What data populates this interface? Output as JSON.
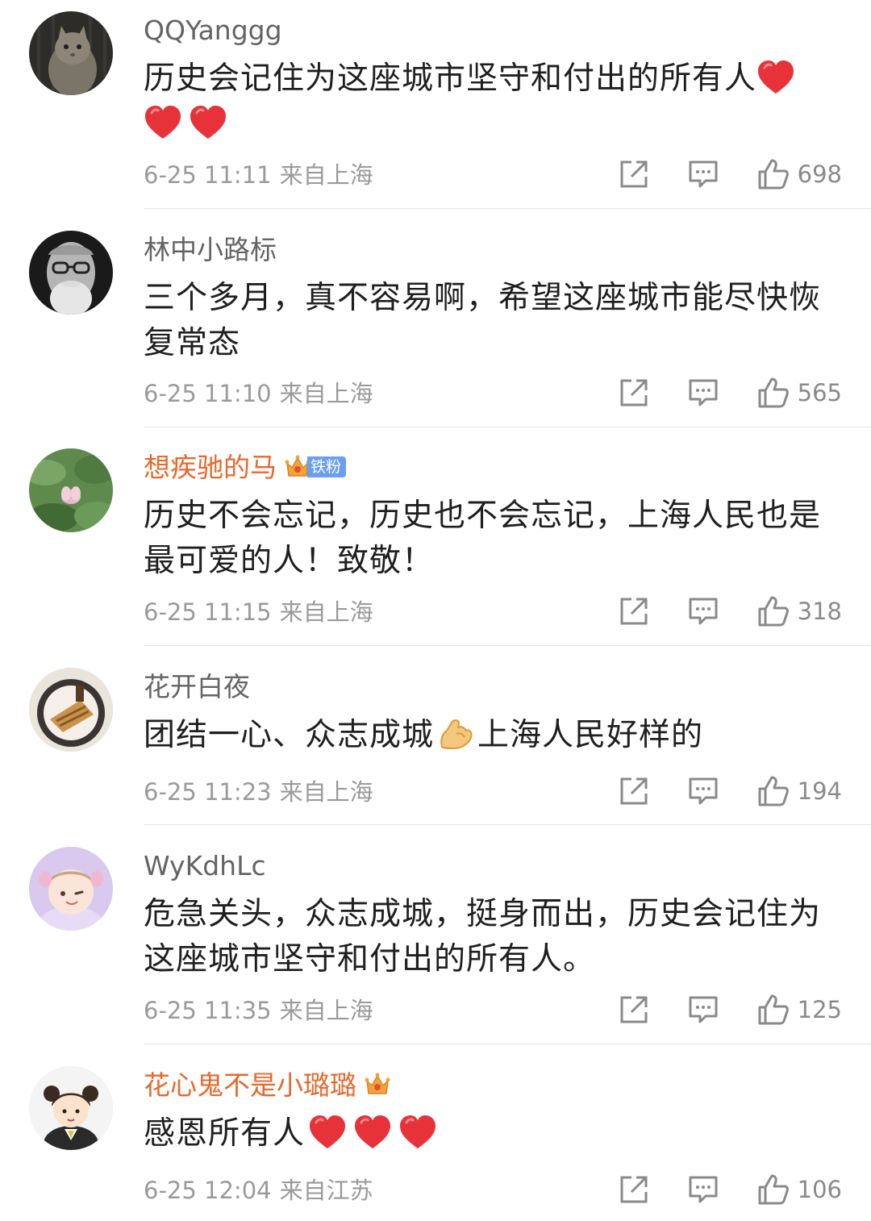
{
  "comments": [
    {
      "username": "QQYanggg",
      "text": "历史会记住为这座城市坚守和付出的所有人",
      "time": "6-25 11:11",
      "location": "来自上海",
      "likes": "698"
    },
    {
      "username": "林中小路标",
      "text": "三个多月，真不容易啊，希望这座城市能尽快恢复常态",
      "time": "6-25 11:10",
      "location": "来自上海",
      "likes": "565"
    },
    {
      "username": "想疾驰的马",
      "fan_badge": "铁粉",
      "text": "历史不会忘记，历史也不会忘记，上海人民也是最可爱的人！致敬！",
      "time": "6-25 11:15",
      "location": "来自上海",
      "likes": "318"
    },
    {
      "username": "花开白夜",
      "text_before": "团结一心、众志成城",
      "text_after": "上海人民好样的",
      "time": "6-25 11:23",
      "location": "来自上海",
      "likes": "194"
    },
    {
      "username": "WyKdhLc",
      "text": "危急关头，众志成城，挺身而出，历史会记住为这座城市坚守和付出的所有人。",
      "time": "6-25 11:35",
      "location": "来自上海",
      "likes": "125"
    },
    {
      "username": "花心鬼不是小璐璐",
      "text": "感恩所有人",
      "time": "6-25 12:04",
      "location": "来自江苏",
      "likes": "106"
    }
  ],
  "icons": {
    "share": "share-icon",
    "comment": "comment-icon",
    "like": "thumbs-up-icon",
    "heart": "red-heart-emoji",
    "muscle": "flexed-biceps-emoji",
    "crown": "crown-badge-icon"
  },
  "colors": {
    "vip_name": "#e8682c",
    "username": "#646464",
    "meta": "#9a9a9a",
    "heart": "#e8323a",
    "fan_badge": "#6a9ff0"
  }
}
